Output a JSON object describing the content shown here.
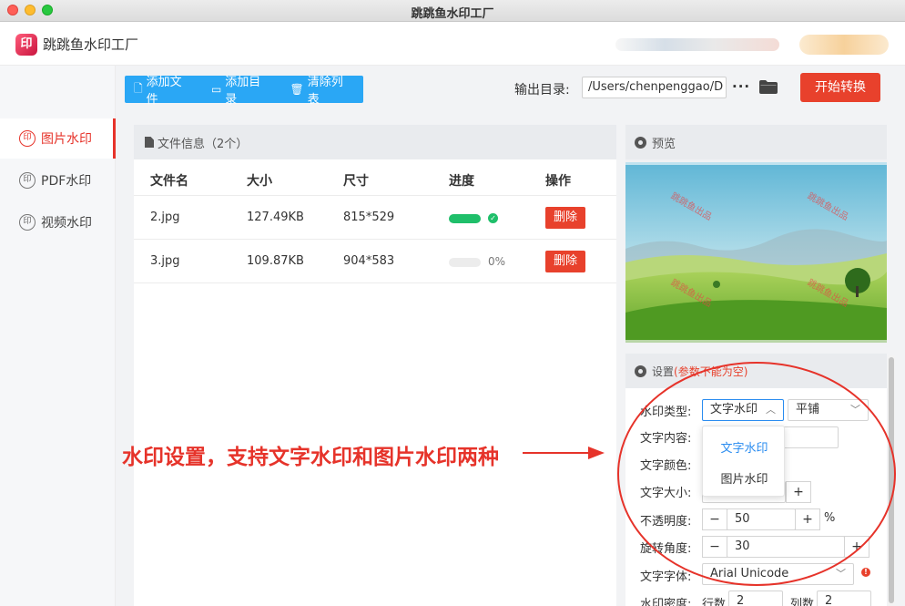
{
  "window": {
    "title": "跳跳鱼水印工厂"
  },
  "app": {
    "name": "跳跳鱼水印工厂",
    "logo_glyph": "印"
  },
  "sidebar": {
    "items": [
      {
        "label": "图片水印",
        "icon": "stamp-icon",
        "active": true
      },
      {
        "label": "PDF水印",
        "icon": "stamp-icon",
        "active": false
      },
      {
        "label": "视频水印",
        "icon": "stamp-icon",
        "active": false
      }
    ]
  },
  "toolbar": {
    "add_file": "添加文件",
    "add_dir": "添加目录",
    "clear_list": "清除列表"
  },
  "output": {
    "label": "输出目录:",
    "path": "/Users/chenpenggao/D",
    "more": "···"
  },
  "start_button": "开始转换",
  "file_panel": {
    "title": "文件信息（2个）",
    "columns": [
      "文件名",
      "大小",
      "尺寸",
      "进度",
      "操作"
    ],
    "rows": [
      {
        "name": "2.jpg",
        "size": "127.49KB",
        "dims": "815*529",
        "progress": 1.0,
        "done": true,
        "pct": "",
        "action": "删除"
      },
      {
        "name": "3.jpg",
        "size": "109.87KB",
        "dims": "904*583",
        "progress": 0.0,
        "done": false,
        "pct": "0%",
        "action": "删除"
      }
    ]
  },
  "preview": {
    "title": "预览",
    "watermark_text": "跳跳鱼出品"
  },
  "settings": {
    "title": "设置",
    "note": "(参数不能为空)",
    "type_label": "水印类型:",
    "type_value": "文字水印",
    "mode_value": "平铺",
    "content_label": "文字内容:",
    "color_label": "文字颜色:",
    "size_label": "文字大小:",
    "opacity_label": "不透明度:",
    "opacity_value": "50",
    "opacity_unit": "%",
    "rotate_label": "旋转角度:",
    "rotate_value": "30",
    "font_label": "文字字体:",
    "font_value": "Arial Unicode",
    "density_label": "水印密度:",
    "rows_label": "行数",
    "rows_value": "2",
    "cols_label": "列数",
    "cols_value": "2",
    "dropdown_options": [
      "文字水印",
      "图片水印"
    ],
    "minus": "−",
    "plus": "+"
  },
  "annotation": {
    "text": "水印设置，支持文字水印和图片水印两种",
    "color": "#e6332a"
  },
  "colors": {
    "accent": "#e8412c",
    "toolbar": "#2aa7f5",
    "success": "#1fbf6a",
    "select": "#2a8cf0"
  }
}
